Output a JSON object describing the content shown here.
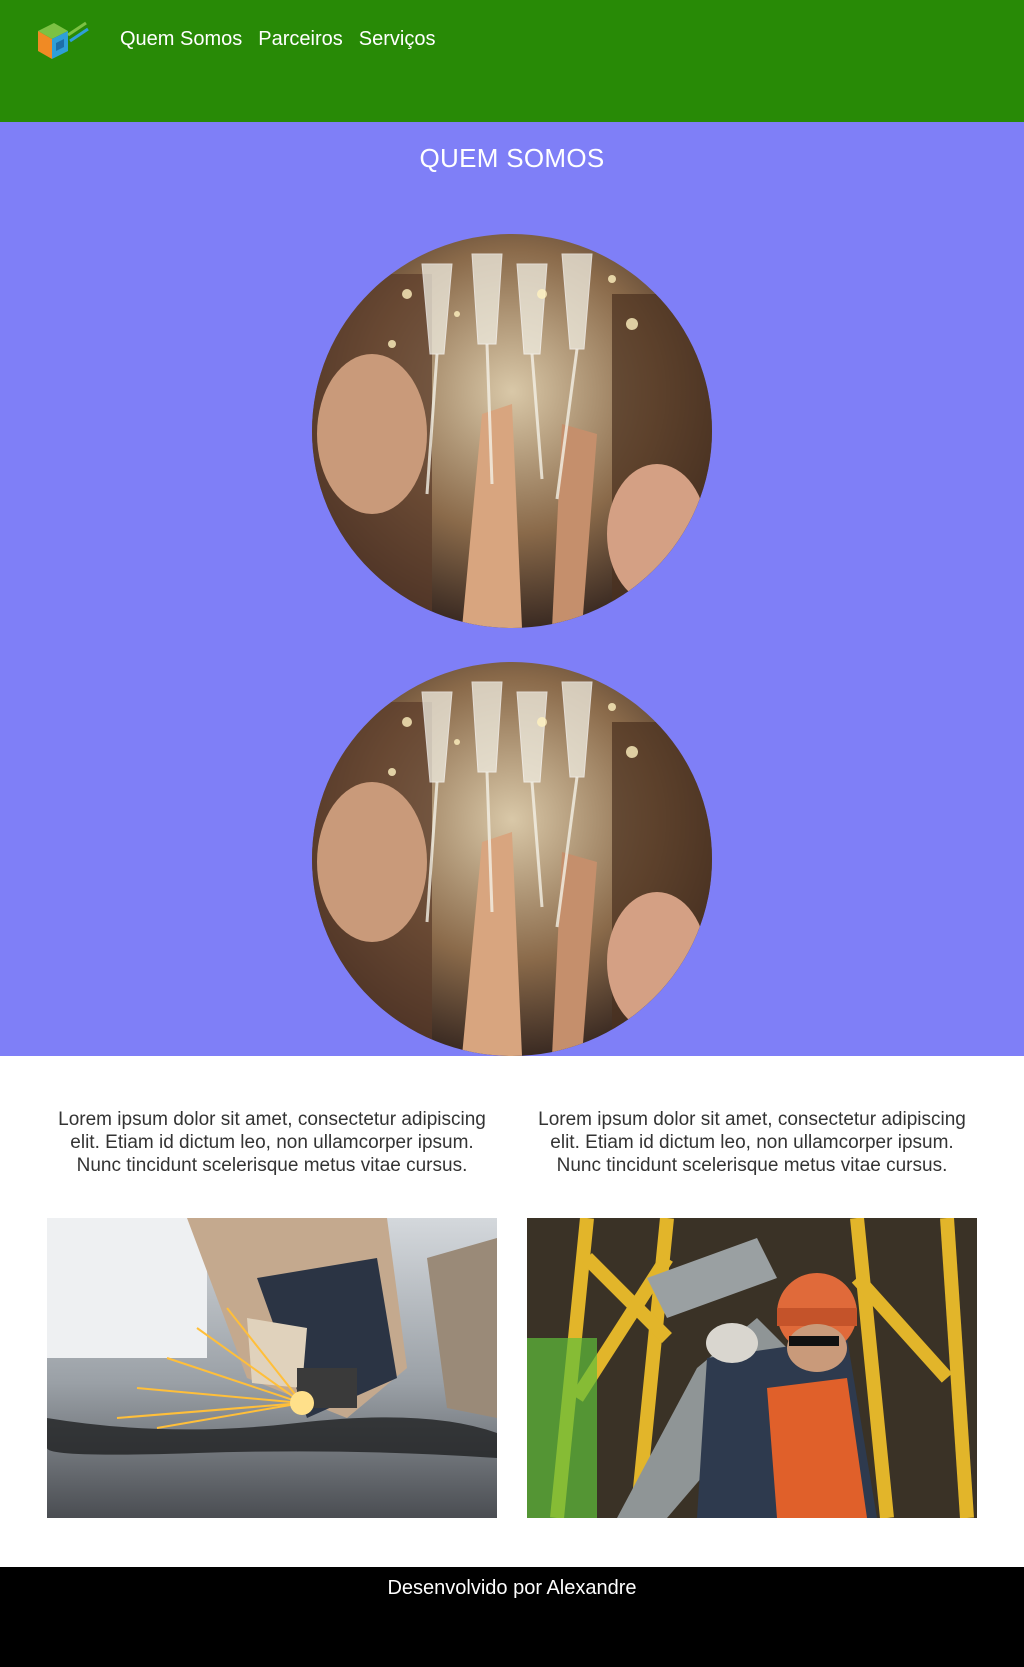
{
  "nav": {
    "logo": "cube-logo",
    "items": [
      "Quem Somos",
      "Parceiros",
      "Serviços"
    ]
  },
  "hero": {
    "title": "QUEM SOMOS",
    "images": [
      "celebration-toast-photo",
      "celebration-toast-photo"
    ]
  },
  "services": [
    {
      "text": "Lorem ipsum dolor sit amet, consectetur adipiscing elit. Etiam id dictum leo, non ullamcorper ipsum. Nunc tincidunt scelerisque metus vitae cursus.",
      "image": "angle-grinder-sparks-photo"
    },
    {
      "text": "Lorem ipsum dolor sit amet, consectetur adipiscing elit. Etiam id dictum leo, non ullamcorper ipsum. Nunc tincidunt scelerisque metus vitae cursus.",
      "image": "construction-worker-photo"
    }
  ],
  "footer": {
    "credit": "Desenvolvido por Alexandre"
  },
  "colors": {
    "header_bg": "#288a06",
    "hero_bg": "#7f7ff7",
    "footer_bg": "#000000",
    "text": "#333333"
  }
}
